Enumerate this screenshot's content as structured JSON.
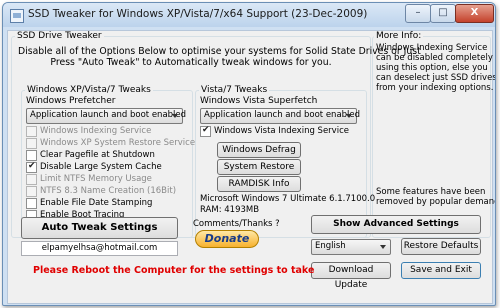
{
  "window": {
    "title": "SSD Tweaker for Windows XP/Vista/7/x64 Support (23-Dec-2009)",
    "minimize": "–",
    "maximize": "□",
    "close": "X"
  },
  "main": {
    "group_label": "SSD Drive Tweaker",
    "intro_line1": "Disable all of the Options Below to optimise your systems for Solid State Drives or Just",
    "intro_line2": "Press \"Auto Tweak\" to Automatically tweak windows for you."
  },
  "more_info": {
    "label": "More Info:",
    "lines": [
      "Windows Indexing Service",
      "can be disabled completely",
      "using this option, else you",
      "can deselect just SSD drives",
      "from your indexing options."
    ],
    "bottom_lines": [
      "Some features have been",
      "removed by popular demand."
    ]
  },
  "xp_group": {
    "label": "Windows XP/Vista/7 Tweaks",
    "prefetcher_label": "Windows Prefetcher",
    "prefetcher_value": "Application launch and boot enabled",
    "checks": [
      {
        "label": "Windows Indexing Service",
        "checked": false,
        "enabled": false
      },
      {
        "label": "Windows XP System Restore Service",
        "checked": false,
        "enabled": false
      },
      {
        "label": "Clear Pagefile at Shutdown",
        "checked": false,
        "enabled": true
      },
      {
        "label": "Disable Large System Cache",
        "checked": true,
        "enabled": true
      },
      {
        "label": "Limit NTFS Memory Usage",
        "checked": false,
        "enabled": false
      },
      {
        "label": "NTFS 8.3 Name Creation (16Bit)",
        "checked": false,
        "enabled": false
      },
      {
        "label": "Enable File Date Stamping",
        "checked": false,
        "enabled": true
      },
      {
        "label": "Enable Boot Tracing",
        "checked": false,
        "enabled": true
      }
    ]
  },
  "vista_group": {
    "label": "Vista/7 Tweaks",
    "superfetch_label": "Windows Vista Superfetch",
    "superfetch_value": "Application launch and boot enabled",
    "indexing_label": "Windows Vista Indexing Service",
    "indexing_checked": true,
    "defrag_button": "Windows Defrag",
    "restore_button": "System Restore",
    "ramdisk_button": "RAMDISK Info",
    "os_info": "Microsoft Windows 7 Ultimate  6.1.7100.0",
    "ram_info": "RAM: 4193MB"
  },
  "bottom": {
    "auto_tweak": "Auto Tweak Settings",
    "email": "elpamyelhsa@hotmail.com",
    "comments_label": "Comments/Thanks ?",
    "donate": "Donate",
    "show_advanced": "Show Advanced Settings",
    "language_value": "English",
    "restore_defaults": "Restore Defaults",
    "download_update": "Download Update",
    "save_exit": "Save and Exit",
    "reboot_warning": "Please Reboot the Computer for the settings to take"
  },
  "colors": {
    "warning": "#e00000",
    "close_button": "#c4422c",
    "donate": "#f7b12e"
  }
}
